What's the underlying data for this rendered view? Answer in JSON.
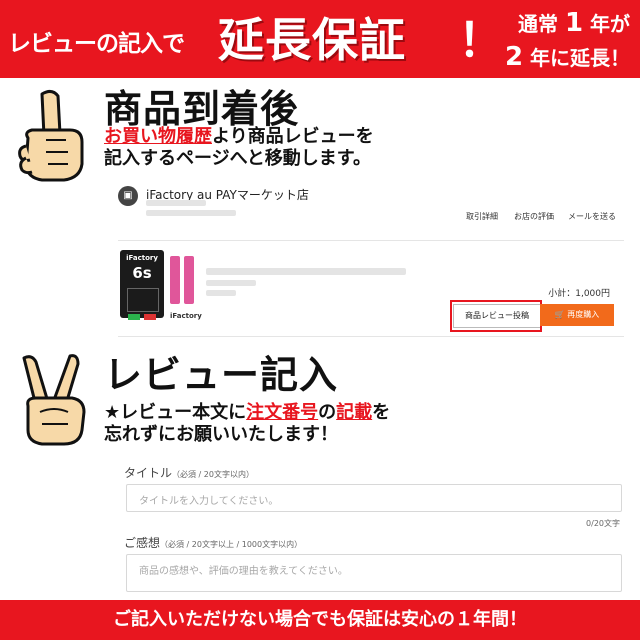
{
  "banner": {
    "lead": "レビューの記入で",
    "headline": "延長保証",
    "headline_mark": "！",
    "note_line1_a": "通常",
    "note_line1_num": "1",
    "note_line1_b": "年が",
    "note_line2_num": "2",
    "note_line2_b": "年に延長！"
  },
  "step1": {
    "title": "商品到着後",
    "desc_red": "お買い物履歴",
    "desc_rest1": "より商品レビューを",
    "desc_line2": "記入するページへと移動します。"
  },
  "order": {
    "shop_name": "iFactory au PAYマーケット店",
    "links": [
      "取引詳細",
      "お店の評価",
      "メールを送る"
    ],
    "product_brand": "iFactory",
    "product_model": "6s",
    "product_maker": "iFactory",
    "subtotal": "小計：1,000円",
    "review_button": "商品レビュー投稿",
    "rebuy_button": "再度購入"
  },
  "step2": {
    "title": "レビュー記入",
    "desc_a": "★レビュー本文に",
    "desc_red1": "注文番号",
    "desc_b": "の",
    "desc_red2": "記載",
    "desc_c": "を",
    "desc_line2": "忘れずにお願いいたします！"
  },
  "form": {
    "title_label": "タイトル",
    "title_note": "（必須 / 20文字以内）",
    "title_placeholder": "タイトルを入力してください。",
    "title_counter": "0/20文字",
    "impression_label": "ご感想",
    "impression_note": "（必須 / 20文字以上 / 1000文字以内）",
    "impression_placeholder": "商品の感想や、評価の理由を教えてください。"
  },
  "footer": {
    "text": "ご記入いただけない場合でも保証は安心の１年間！"
  },
  "colors": {
    "accent": "#e8161f",
    "buy_button": "#f26a1b"
  }
}
